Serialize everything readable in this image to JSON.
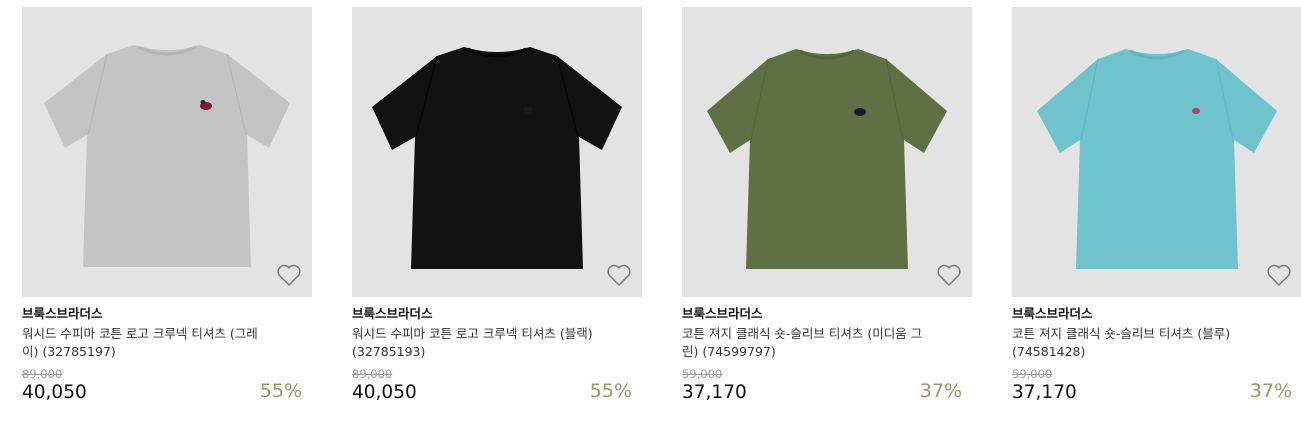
{
  "products": [
    {
      "brand": "브룩스브라더스",
      "name": "워시드 수피마 코튼 로고 크루넥 티셔츠 (그레이) (32785197)",
      "original_price": "89,000",
      "price": "40,050",
      "discount": "55%",
      "shirt_color": "#c4c4c4",
      "shirt_shade": "#b4b4b4",
      "wishlist_icon": "heart-outline-icon"
    },
    {
      "brand": "브룩스브라더스",
      "name": "워시드 수피마 코튼 로고 크루넥 티셔츠 (블랙) (32785193)",
      "original_price": "89,000",
      "price": "40,050",
      "discount": "55%",
      "shirt_color": "#121212",
      "shirt_shade": "#050505",
      "wishlist_icon": "heart-outline-icon"
    },
    {
      "brand": "브룩스브라더스",
      "name": "코튼 져지 클래식 숏-슬리브 티셔츠 (미디움 그린) (74599797)",
      "original_price": "59,000",
      "price": "37,170",
      "discount": "37%",
      "shirt_color": "#5f7144",
      "shirt_shade": "#52633a",
      "wishlist_icon": "heart-outline-icon"
    },
    {
      "brand": "브룩스브라더스",
      "name": "코튼 져지 클래식 숏-슬리브 티셔츠 (블루) (74581428)",
      "original_price": "59,000",
      "price": "37,170",
      "discount": "37%",
      "shirt_color": "#6ec3cd",
      "shirt_shade": "#5fb4bf",
      "wishlist_icon": "heart-outline-icon"
    }
  ],
  "colors": {
    "image_background": "#e3e3e3",
    "discount": "#a09366"
  }
}
